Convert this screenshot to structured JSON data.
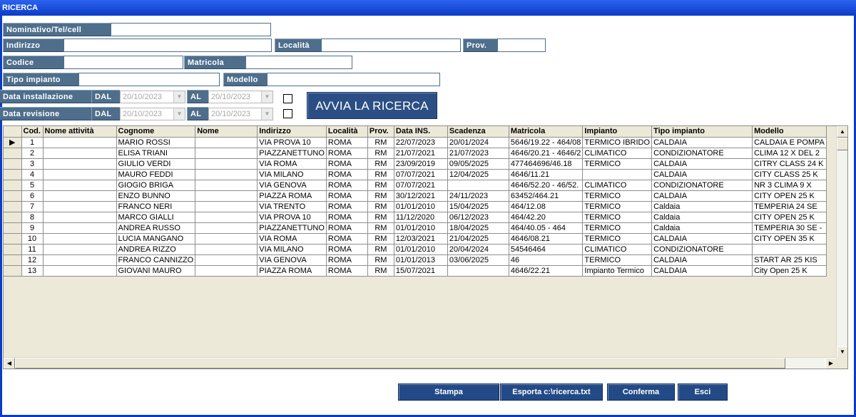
{
  "window": {
    "title": "RICERCA"
  },
  "form": {
    "nominativo_label": "Nominativo/Tel/cell",
    "nominativo_value": "",
    "indirizzo_label": "Indirizzo",
    "indirizzo_value": "",
    "localita_label": "Località",
    "localita_value": "",
    "prov_label": "Prov.",
    "prov_value": "",
    "codice_label": "Codice",
    "codice_value": "",
    "matricola_label": "Matricola",
    "matricola_value": "",
    "tipo_impianto_label": "Tipo impianto",
    "tipo_impianto_value": "",
    "modello_label": "Modello",
    "modello_value": "",
    "data_installazione_label": "Data installazione",
    "data_revisione_label": "Data revisione",
    "dal_label": "DAL",
    "al_label": "AL",
    "inst_dal_value": "20/10/2023",
    "inst_al_value": "20/10/2023",
    "rev_dal_value": "20/10/2023",
    "rev_al_value": "20/10/2023",
    "search_button": "AVVIA LA RICERCA"
  },
  "grid": {
    "columns": [
      "Cod.",
      "Nome attività",
      "Cognome",
      "Nome",
      "Indirizzo",
      "Località",
      "Prov.",
      "Data INS.",
      "Scadenza",
      "Matricola",
      "Impianto",
      "Tipo impianto",
      "Modello"
    ],
    "rows": [
      [
        "1",
        "",
        "MARIO ROSSI",
        "",
        "VIA PROVA 10",
        "ROMA",
        "RM",
        "22/07/2023",
        "20/01/2024",
        "5646/19.22 - 464/08",
        "TERMICO IBRIDO",
        "CALDAIA",
        "CALDAIA E POMPA"
      ],
      [
        "2",
        "",
        "ELISA TRIANI",
        "",
        "PIAZZANETTUNO",
        "ROMA",
        "RM",
        "21/07/2021",
        "21/07/2023",
        "4646/20.21 - 4646/2",
        "CLIMATICO",
        "CONDIZIONATORE",
        "CLIMA 12 X  DEL 2"
      ],
      [
        "3",
        "",
        "GIULIO VERDI",
        "",
        "VIA ROMA",
        "ROMA",
        "RM",
        "23/09/2019",
        "09/05/2025",
        "477464696/46.18",
        "TERMICO",
        "CALDAIA",
        "CITRY CLASS 24 K"
      ],
      [
        "4",
        "",
        "MAURO FEDDI",
        "",
        "VIA MILANO",
        "ROMA",
        "RM",
        "07/07/2021",
        "12/04/2025",
        "4646/11.21",
        "",
        "CALDAIA",
        "CITY CLASS 25 K"
      ],
      [
        "5",
        "",
        "GIOGIO BRIGA",
        "",
        "VIA GENOVA",
        "ROMA",
        "RM",
        "07/07/2021",
        "",
        "4646/52.20 - 46/52.",
        "CLIMATICO",
        "CONDIZIONATORE",
        "NR 3 CLIMA 9 X"
      ],
      [
        "6",
        "",
        "ENZO BUNNO",
        "",
        "PIAZZA ROMA",
        "ROMA",
        "RM",
        "30/12/2021",
        "24/11/2023",
        "63452/464.21",
        "TERMICO",
        "CALDAIA",
        "CITY OPEN 25 K"
      ],
      [
        "7",
        "",
        "FRANCO NERI",
        "",
        "VIA TRENTO",
        "ROMA",
        "RM",
        "01/01/2010",
        "15/04/2025",
        "464/12.08",
        "TERMICO",
        "Caldaia",
        "TEMPERIA 24 SE"
      ],
      [
        "8",
        "",
        "MARCO GIALLI",
        "",
        "VIA PROVA 10",
        "ROMA",
        "RM",
        "11/12/2020",
        "06/12/2023",
        "464/42.20",
        "TERMICO",
        "Caldaia",
        "CITY OPEN 25 K"
      ],
      [
        "9",
        "",
        "ANDREA RUSSO",
        "",
        "PIAZZANETTUNO",
        "ROMA",
        "RM",
        "01/01/2010",
        "18/04/2025",
        "464/40.05 - 464",
        "TERMICO",
        "Caldaia",
        "TEMPERIA 30 SE -"
      ],
      [
        "10",
        "",
        "LUCIA MANGANO",
        "",
        "VIA ROMA",
        "ROMA",
        "RM",
        "12/03/2021",
        "21/04/2025",
        "4646/08.21",
        "TERMICO",
        "CALDAIA",
        "CITY OPEN 35 K"
      ],
      [
        "11",
        "",
        "ANDREA RIZZO",
        "",
        "VIA MILANO",
        "ROMA",
        "RM",
        "01/01/2010",
        "20/04/2024",
        "54546464",
        "CLIMATICO",
        "CONDIZIONATORE",
        ""
      ],
      [
        "12",
        "",
        "FRANCO CANNIZZO",
        "",
        "VIA GENOVA",
        "ROMA",
        "RM",
        "01/01/2013",
        "03/06/2025",
        "46",
        "TERMICO",
        "CALDAIA",
        "START AR 25 KIS"
      ],
      [
        "13",
        "",
        "GIOVANI MAURO",
        "",
        "PIAZZA ROMA",
        "ROMA",
        "RM",
        "15/07/2021",
        "",
        "4646/22.21",
        "Impianto Termico",
        "CALDAIA",
        "City Open 25 K"
      ]
    ]
  },
  "buttons": {
    "stampa": "Stampa",
    "esporta": "Esporta c:\\ricerca.txt",
    "conferma": "Conferma",
    "esci": "Esci"
  },
  "icons": {
    "row_pointer": "▶",
    "scroll_up": "▲",
    "scroll_down": "▼",
    "scroll_left": "◀",
    "scroll_right": "▶",
    "dropdown": "▼"
  }
}
